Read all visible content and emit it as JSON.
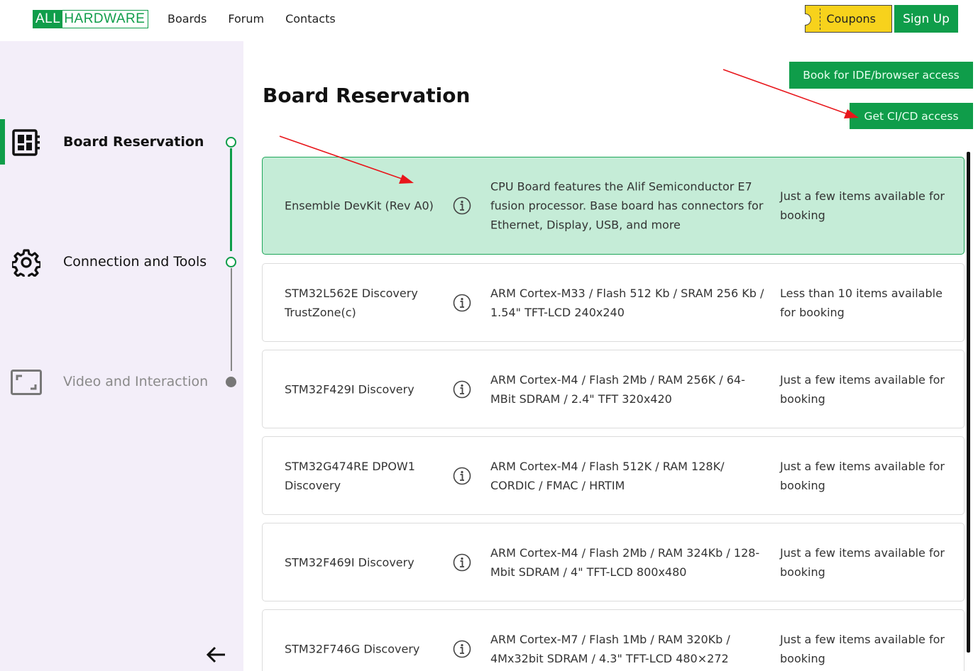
{
  "brand": {
    "all": "ALL",
    "hardware": "HARDWARE"
  },
  "nav": {
    "boards": "Boards",
    "forum": "Forum",
    "contacts": "Contacts"
  },
  "header_buttons": {
    "coupons": "Coupons",
    "signup": "Sign Up"
  },
  "sidebar": {
    "steps": [
      {
        "label": "Board Reservation",
        "icon": "board-icon",
        "state": "active"
      },
      {
        "label": "Connection and Tools",
        "icon": "gear-icon",
        "state": "pending"
      },
      {
        "label": "Video and Interaction",
        "icon": "video-frame-icon",
        "state": "disabled"
      }
    ]
  },
  "main": {
    "title": "Board Reservation",
    "book_ide_label": "Book for IDE/browser access",
    "cicd_label": "Get CI/CD access",
    "boards": [
      {
        "name": "Ensemble DevKit (Rev A0)",
        "description": "CPU Board features the Alif Semiconductor E7 fusion processor. Base board has connectors for Ethernet, Display, USB, and more",
        "availability": "Just a few items available for booking",
        "selected": true
      },
      {
        "name": "STM32L562E Discovery TrustZone(c)",
        "description": "ARM Cortex-M33 / Flash 512 Kb / SRAM 256 Kb / 1.54\" TFT-LCD 240x240",
        "availability": "Less than 10 items available for booking",
        "selected": false
      },
      {
        "name": "STM32F429I Discovery",
        "description": "ARM Cortex-M4 / Flash 2Mb / RAM 256K / 64-MBit SDRAM / 2.4\" TFT 320x420",
        "availability": "Just a few items available for booking",
        "selected": false
      },
      {
        "name": "STM32G474RE DPOW1 Discovery",
        "description": "ARM Cortex-M4 / Flash 512K / RAM 128K/ CORDIC / FMAC / HRTIM",
        "availability": "Just a few items available for booking",
        "selected": false
      },
      {
        "name": "STM32F469I Discovery",
        "description": "ARM Cortex-M4 / Flash 2Mb / RAM 324Kb / 128-Mbit SDRAM / 4\" TFT-LCD 800x480",
        "availability": "Just a few items available for booking",
        "selected": false
      },
      {
        "name": "STM32F746G Discovery",
        "description": "ARM Cortex-M7 / Flash 1Mb / RAM 320Kb / 4Mx32bit SDRAM / 4.3\" TFT-LCD 480×272",
        "availability": "Just a few items available for booking",
        "selected": false
      }
    ]
  },
  "colors": {
    "brand_green": "#0f9d4a",
    "selected_card_bg": "#c5ecd7",
    "coupon_yellow": "#f7d21c",
    "sidebar_bg": "#f3eef9",
    "annotation_red": "#e8161b"
  }
}
